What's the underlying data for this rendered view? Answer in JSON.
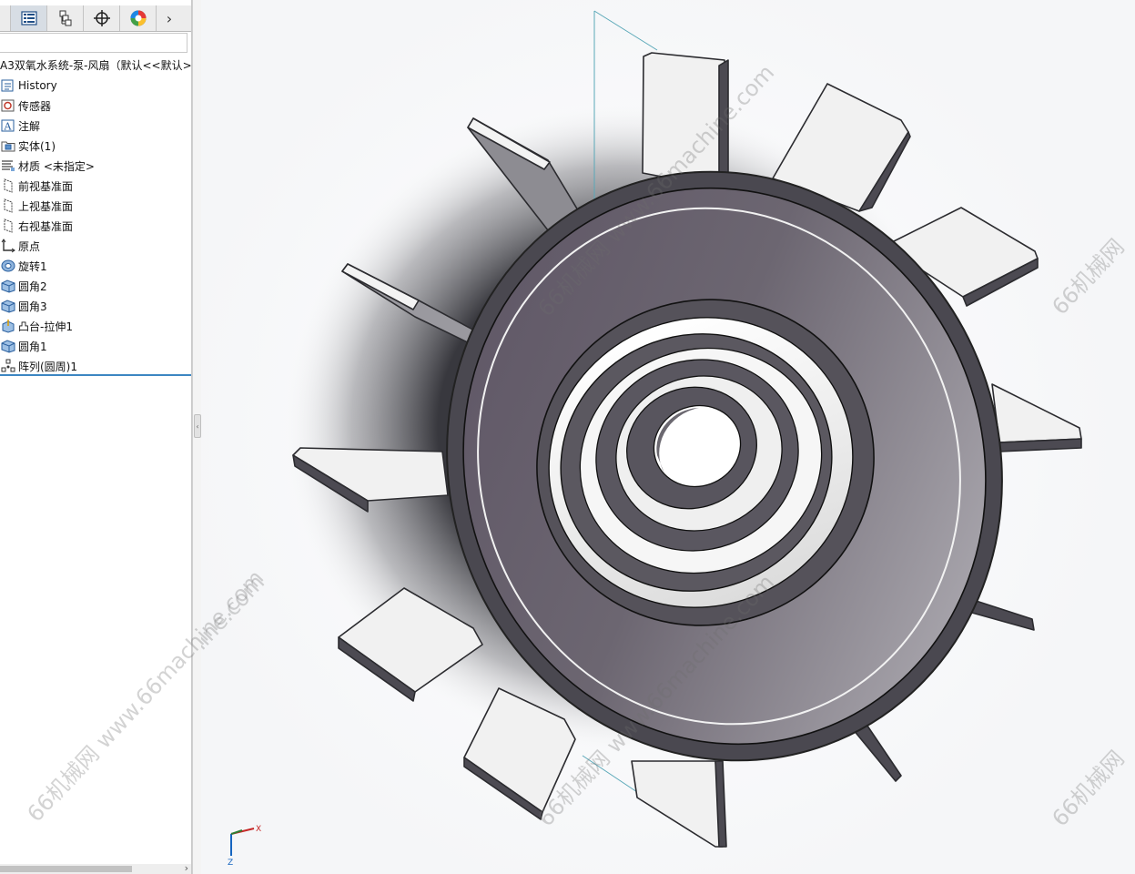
{
  "feature_tree": {
    "document_title": "A3双氧水系统-泵-风扇（默认<<默认>_",
    "items": [
      {
        "label": "History",
        "icon": "history-icon"
      },
      {
        "label": "传感器",
        "icon": "sensor-icon"
      },
      {
        "label": "注解",
        "icon": "annotation-icon"
      },
      {
        "label": "实体(1)",
        "icon": "solid-bodies-icon"
      },
      {
        "label": "材质 <未指定>",
        "icon": "material-icon"
      },
      {
        "label": "前视基准面",
        "icon": "plane-icon"
      },
      {
        "label": "上视基准面",
        "icon": "plane-icon"
      },
      {
        "label": "右视基准面",
        "icon": "plane-icon"
      },
      {
        "label": "原点",
        "icon": "origin-icon"
      },
      {
        "label": "旋转1",
        "icon": "revolve-icon"
      },
      {
        "label": "圆角2",
        "icon": "fillet-icon"
      },
      {
        "label": "圆角3",
        "icon": "fillet-icon"
      },
      {
        "label": "凸台-拉伸1",
        "icon": "extrude-icon"
      },
      {
        "label": "圆角1",
        "icon": "fillet-icon"
      },
      {
        "label": "阵列(圆周)1",
        "icon": "circular-pattern-icon"
      }
    ]
  },
  "tabs": [
    {
      "name": "feature-manager-tab",
      "icon": "feature-tree-icon"
    },
    {
      "name": "property-manager-tab",
      "icon": "property-manager-icon"
    },
    {
      "name": "configuration-manager-tab",
      "icon": "configuration-icon"
    },
    {
      "name": "dimxpert-tab",
      "icon": "target-icon"
    },
    {
      "name": "display-manager-tab",
      "icon": "appearance-icon"
    }
  ],
  "triad": {
    "x_label": "X",
    "z_label": "Z"
  },
  "watermarks": [
    "66机械网 www.66machine.com",
    "66机械网"
  ],
  "colors": {
    "part_dark": "#4a4850",
    "blade_light": "#f1f1f1",
    "accent": "#3d86c2"
  }
}
